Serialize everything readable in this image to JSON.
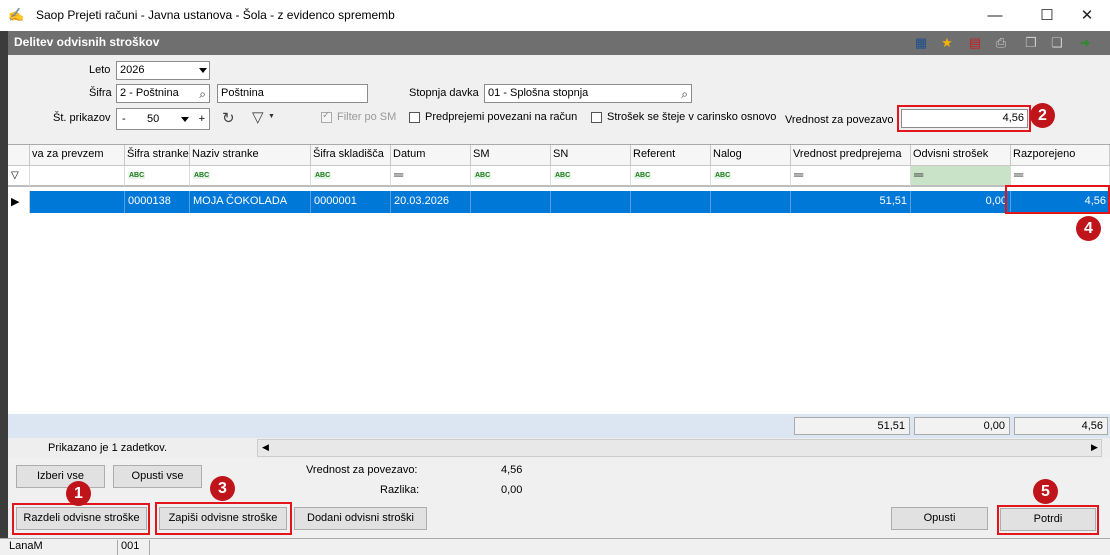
{
  "window": {
    "title": "Saop Prejeti računi - Javna ustanova - Šola - z evidenco sprememb",
    "minimize": "—",
    "maximize": "☐",
    "close": "✕"
  },
  "header": {
    "title": "Delitev odvisnih stroškov",
    "toolbar_icons": [
      "table-layout-icon",
      "star-icon",
      "pdf-icon",
      "print-icon",
      "copy-icon",
      "paste-icon",
      "exit-icon"
    ]
  },
  "filters": {
    "leto_label": "Leto",
    "leto_value": "2026",
    "sifra_label": "Šifra",
    "sifra_value": "2 - Poštnina",
    "sifra_name": "Poštnina",
    "stevilo_label": "Št. prikazov",
    "stevilo_minus": "-",
    "stevilo_value": "50",
    "stevilo_plus": "+",
    "stopnja_label": "Stopnja davka",
    "stopnja_value": "01 - Splošna stopnja",
    "filter_sm_label": "Filter po SM",
    "predprejemi_label": "Predprejemi povezani na račun",
    "strosek_label": "Strošek se šteje v carinsko osnovo",
    "vrednost_label": "Vrednost za povezavo",
    "vrednost_value": "4,56"
  },
  "grid": {
    "columns": [
      "va za prevzem",
      "Šifra stranke",
      "Naziv stranke",
      "Šifra skladišča",
      "Datum",
      "SM",
      "SN",
      "Referent",
      "Nalog",
      "Vrednost predprejema",
      "Odvisni strošek",
      "Razporejeno"
    ],
    "filter_abc": "ABC",
    "filter_eq": "═",
    "rows": [
      {
        "indicator": "▶",
        "va_za_prevzem": "",
        "sifra_stranke": "0000138",
        "naziv_stranke": "MOJA ČOKOLADA",
        "sifra_skladisca": "0000001",
        "datum": "20.03.2026",
        "sm": "",
        "sn": "",
        "referent": "",
        "nalog": "",
        "vrednost_predprejema": "51,51",
        "odvisni_strosek": "0,00",
        "razporejeno": "4,56"
      }
    ],
    "totals": {
      "vrednost_predprejema": "51,51",
      "odvisni_strosek": "0,00",
      "razporejeno": "4,56"
    },
    "record_count": "Prikazano je 1 zadetkov."
  },
  "summary": {
    "vrednost_label": "Vrednost za povezavo:",
    "vrednost_value": "4,56",
    "razlika_label": "Razlika:",
    "razlika_value": "0,00"
  },
  "buttons": {
    "izberi_vse": "Izberi vse",
    "opusti_vse": "Opusti vse",
    "razdeli": "Razdeli odvisne stroške",
    "zapisi": "Zapiši odvisne stroške",
    "dodani": "Dodani odvisni stroški",
    "opusti": "Opusti",
    "potrdi": "Potrdi"
  },
  "badges": [
    "1",
    "2",
    "3",
    "4",
    "5"
  ],
  "statusbar": {
    "user": "LanaM",
    "code": "001"
  },
  "colors": {
    "selection": "#0078d7",
    "highlight": "#e3141b",
    "badge": "#c0141b",
    "header_bar": "#6f6f6f"
  }
}
